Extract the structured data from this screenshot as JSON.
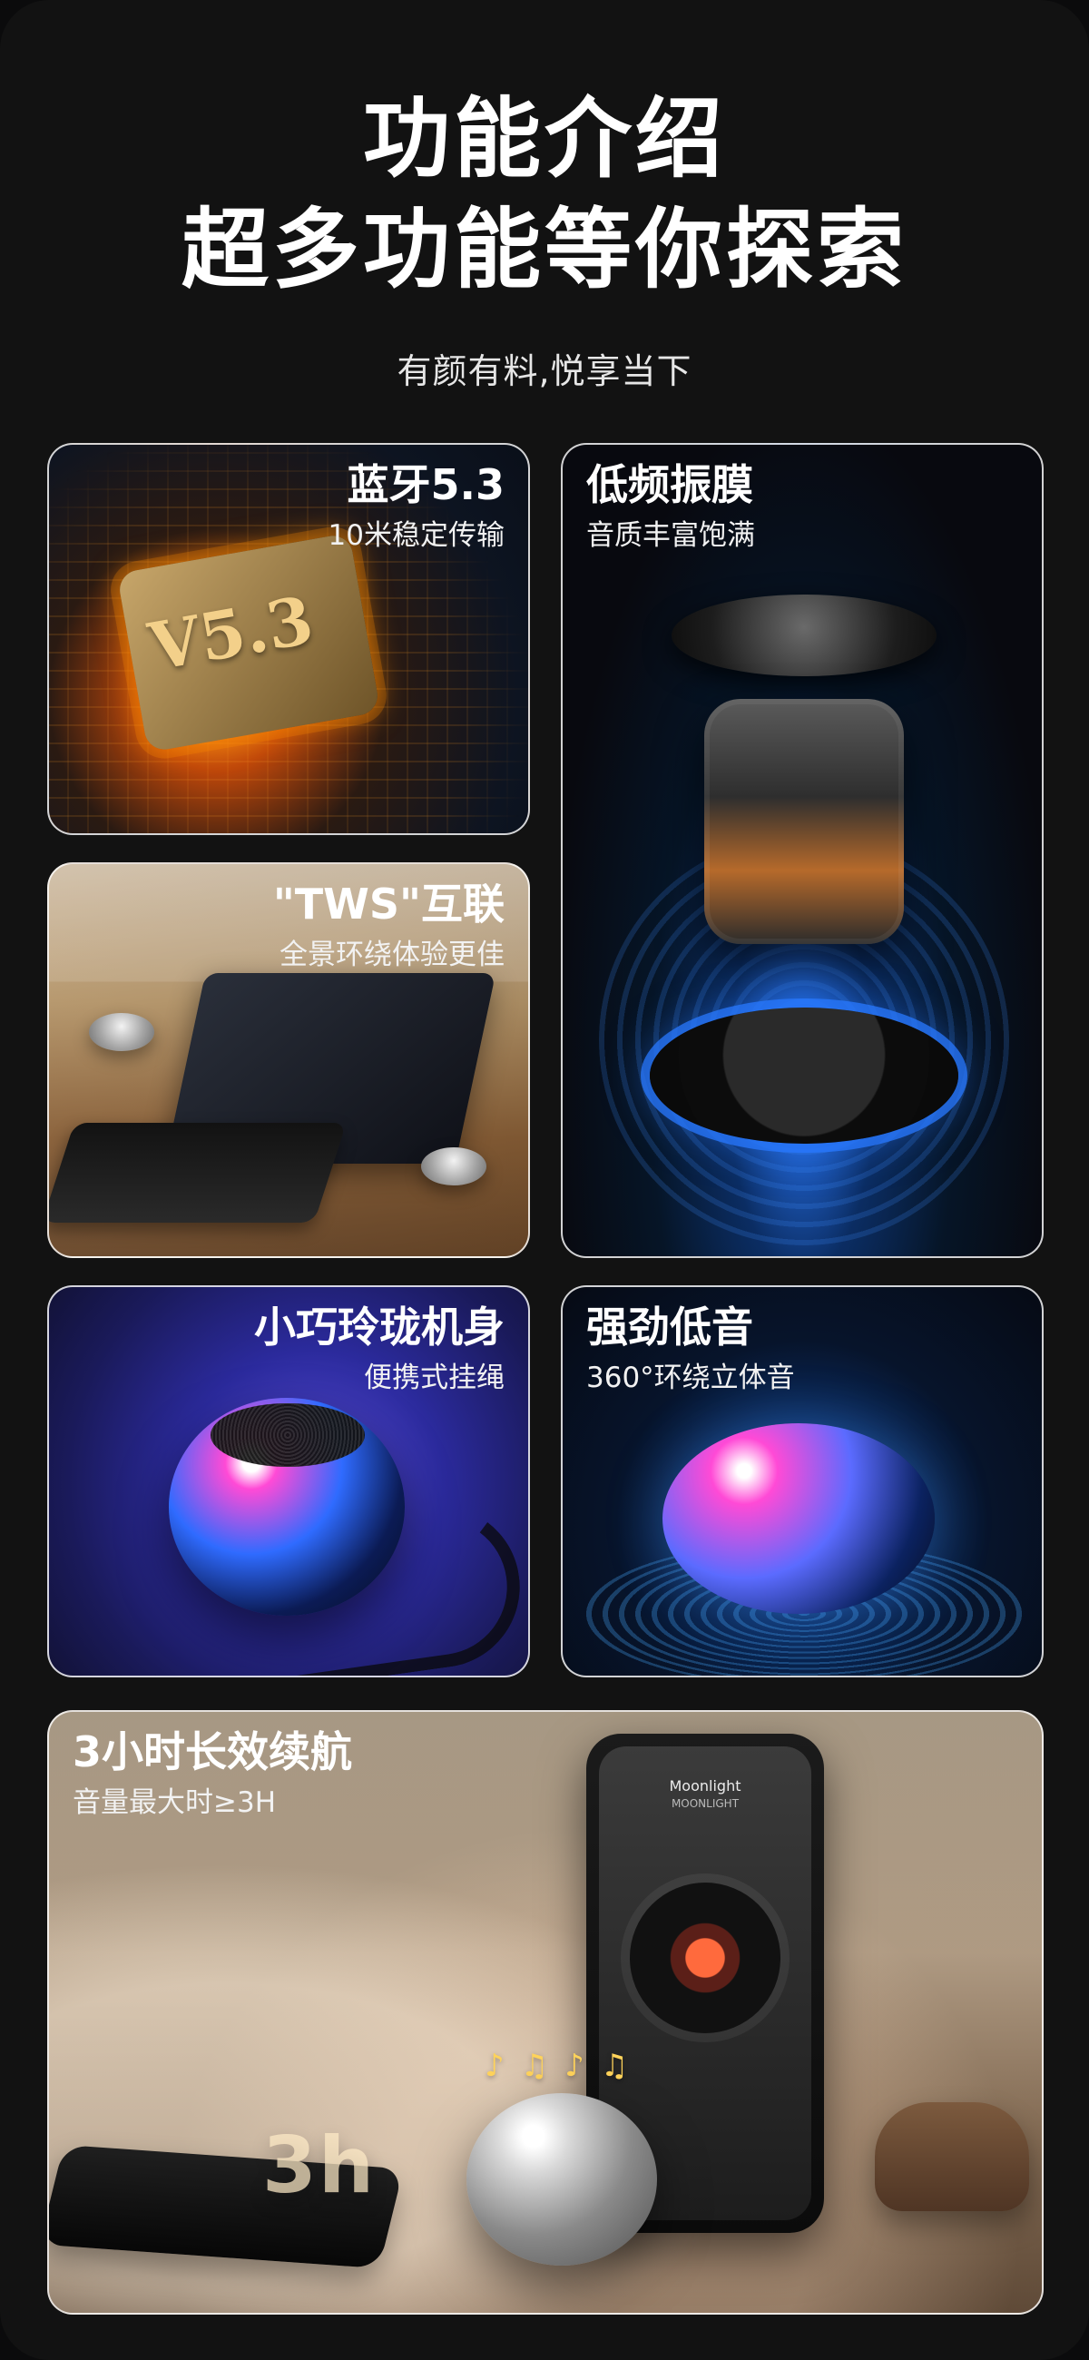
{
  "header": {
    "line1": "功能介绍",
    "line2": "超多功能等你探索",
    "subtitle": "有颜有料,悦享当下"
  },
  "cards": [
    {
      "key": "bluetooth",
      "title": "蓝牙5.3",
      "desc": "10米稳定传输",
      "badge": "V5.3"
    },
    {
      "key": "driver",
      "title": "低频振膜",
      "desc": "音质丰富饱满"
    },
    {
      "key": "tws",
      "title": "\"TWS\"互联",
      "desc": "全景环绕体验更佳"
    },
    {
      "key": "compact",
      "title": "小巧玲珑机身",
      "desc": "便携式挂绳"
    },
    {
      "key": "bass",
      "title": "强劲低音",
      "desc": "360°环绕立体音"
    },
    {
      "key": "battery",
      "title": "3小时长效续航",
      "desc": "音量最大时≥3H",
      "badge": "3h",
      "phone": {
        "song": "Moonlight",
        "album": "MOONLIGHT"
      }
    }
  ],
  "icons": {
    "music_notes": "music-notes-icon"
  }
}
